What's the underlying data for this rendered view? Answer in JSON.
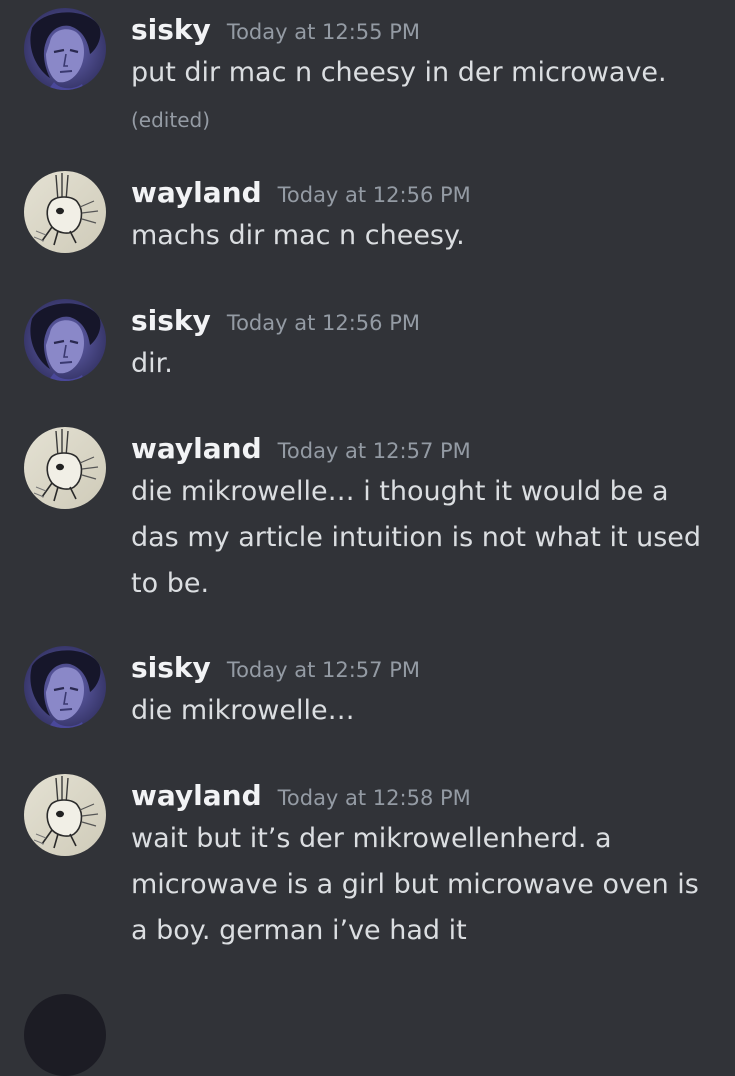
{
  "theme": {
    "background": "#313338",
    "username_color": "#f2f3f5",
    "text_color": "#dbdee1",
    "muted_color": "#949ba4"
  },
  "messages": [
    {
      "username": "sisky",
      "timestamp": "Today at 12:55 PM",
      "text": "put dir mac n cheesy in der microwave.",
      "edited": "(edited)",
      "avatar": "sisky-avatar"
    },
    {
      "username": "wayland",
      "timestamp": "Today at 12:56 PM",
      "text": "machs dir mac n cheesy.",
      "avatar": "wayland-avatar"
    },
    {
      "username": "sisky",
      "timestamp": "Today at 12:56 PM",
      "text": "dir.",
      "avatar": "sisky-avatar"
    },
    {
      "username": "wayland",
      "timestamp": "Today at 12:57 PM",
      "text": "die mikrowelle… i thought it would be a das my article intuition is not what it used to be.",
      "avatar": "wayland-avatar"
    },
    {
      "username": "sisky",
      "timestamp": "Today at 12:57 PM",
      "text": "die mikrowelle…",
      "avatar": "sisky-avatar"
    },
    {
      "username": "wayland",
      "timestamp": "Today at 12:58 PM",
      "text": "wait but it’s der mikrowellenherd. a microwave is a girl but microwave oven is a boy. german i’ve had it",
      "avatar": "wayland-avatar"
    }
  ]
}
